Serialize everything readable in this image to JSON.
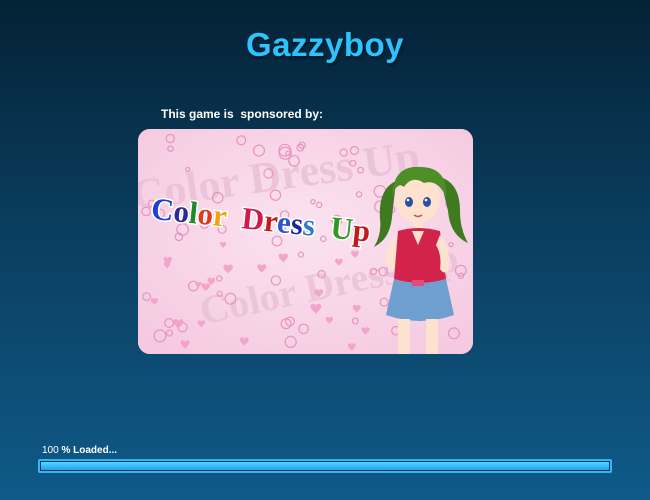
{
  "header": {
    "title": "Gazzyboy"
  },
  "sponsor": {
    "label": "This game is  sponsored by:",
    "banner_title": "Color Dress Up",
    "banner_bg_text": "Color Dress Up"
  },
  "loader": {
    "percent_value": "100",
    "percent_unit": "% Loaded...",
    "progress": 1.0
  },
  "colors": {
    "title": "#2cc3ff",
    "bar_border": "#2bb8ff",
    "bar_fill": "#1aa6ea",
    "banner_bg": "#f8d4e8"
  }
}
